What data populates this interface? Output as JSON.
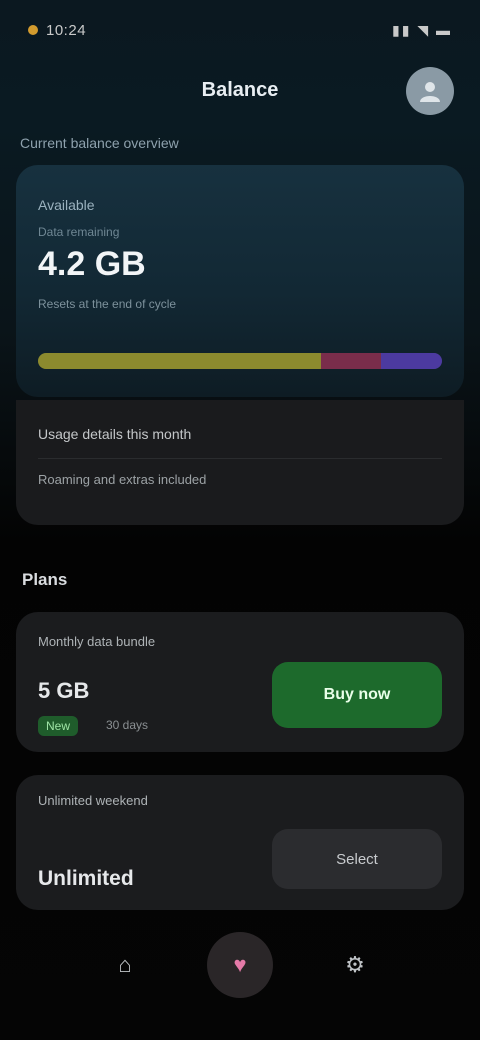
{
  "status_bar": {
    "time": "10:24",
    "icons": "▮▮ ◥ ▬"
  },
  "header": {
    "title": "Balance",
    "profile_icon": "person-icon"
  },
  "balance": {
    "section_label": "Current balance overview",
    "card_label": "Available",
    "card_sub": "Data remaining",
    "amount": "4.2 GB",
    "note": "Resets at the end of cycle",
    "usage": {
      "used_fraction": 0.7,
      "reserved_fraction": 0.15,
      "extra_fraction": 0.15
    },
    "colors": {
      "used": "#8c8a2e",
      "reserved": "#7a2d4b",
      "extra": "#4c3aa0"
    }
  },
  "info": {
    "row1": "Usage details this month",
    "row2": "Roaming and extras included"
  },
  "plans": {
    "heading": "Plans",
    "plan1": {
      "name": "Monthly data bundle",
      "price": "5 GB",
      "badge": "New",
      "period": "30 days",
      "button": "Buy now"
    },
    "plan2": {
      "name": "Unlimited weekend",
      "price": "Unlimited",
      "button": "Select"
    },
    "accent_color": "#1d6a2c"
  },
  "nav": {
    "items": [
      {
        "icon": "home-icon",
        "glyph": "⌂"
      },
      {
        "icon": "heart-icon",
        "glyph": "♥"
      },
      {
        "icon": "settings-icon",
        "glyph": "⚙"
      }
    ]
  }
}
